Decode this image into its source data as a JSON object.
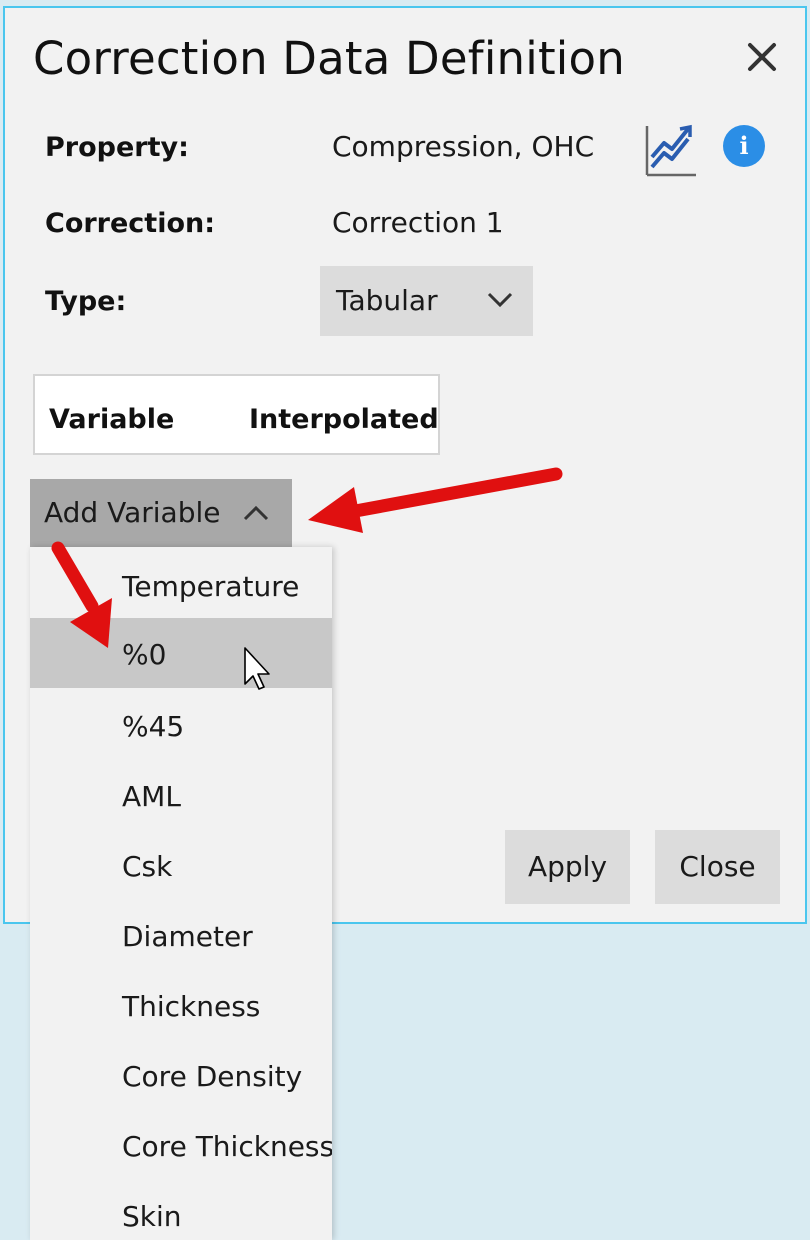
{
  "dialog": {
    "title": "Correction Data Definition",
    "close_icon": "close-icon"
  },
  "fields": {
    "property_label": "Property:",
    "property_value": "Compression, OHC",
    "correction_label": "Correction:",
    "correction_value": "Correction 1",
    "type_label": "Type:",
    "type_value": "Tabular"
  },
  "icons": {
    "chart": "trend-chart-icon",
    "info": "info-icon",
    "info_glyph": "i"
  },
  "variables_table": {
    "columns": [
      "Variable",
      "Interpolated"
    ]
  },
  "add_variable": {
    "label": "Add Variable",
    "expanded": true,
    "options": [
      "Temperature",
      "%0",
      "%45",
      "AML",
      "Csk",
      "Diameter",
      "Thickness",
      "Core Density",
      "Core Thickness",
      "Skin"
    ],
    "hovered_option": "%0"
  },
  "buttons": {
    "apply": "Apply",
    "close": "Close"
  },
  "colors": {
    "accent_border": "#4ac6ee",
    "annotation_arrow": "#e01010",
    "info_blue": "#2b8ee6",
    "chart_icon_blue": "#2a5db0"
  }
}
